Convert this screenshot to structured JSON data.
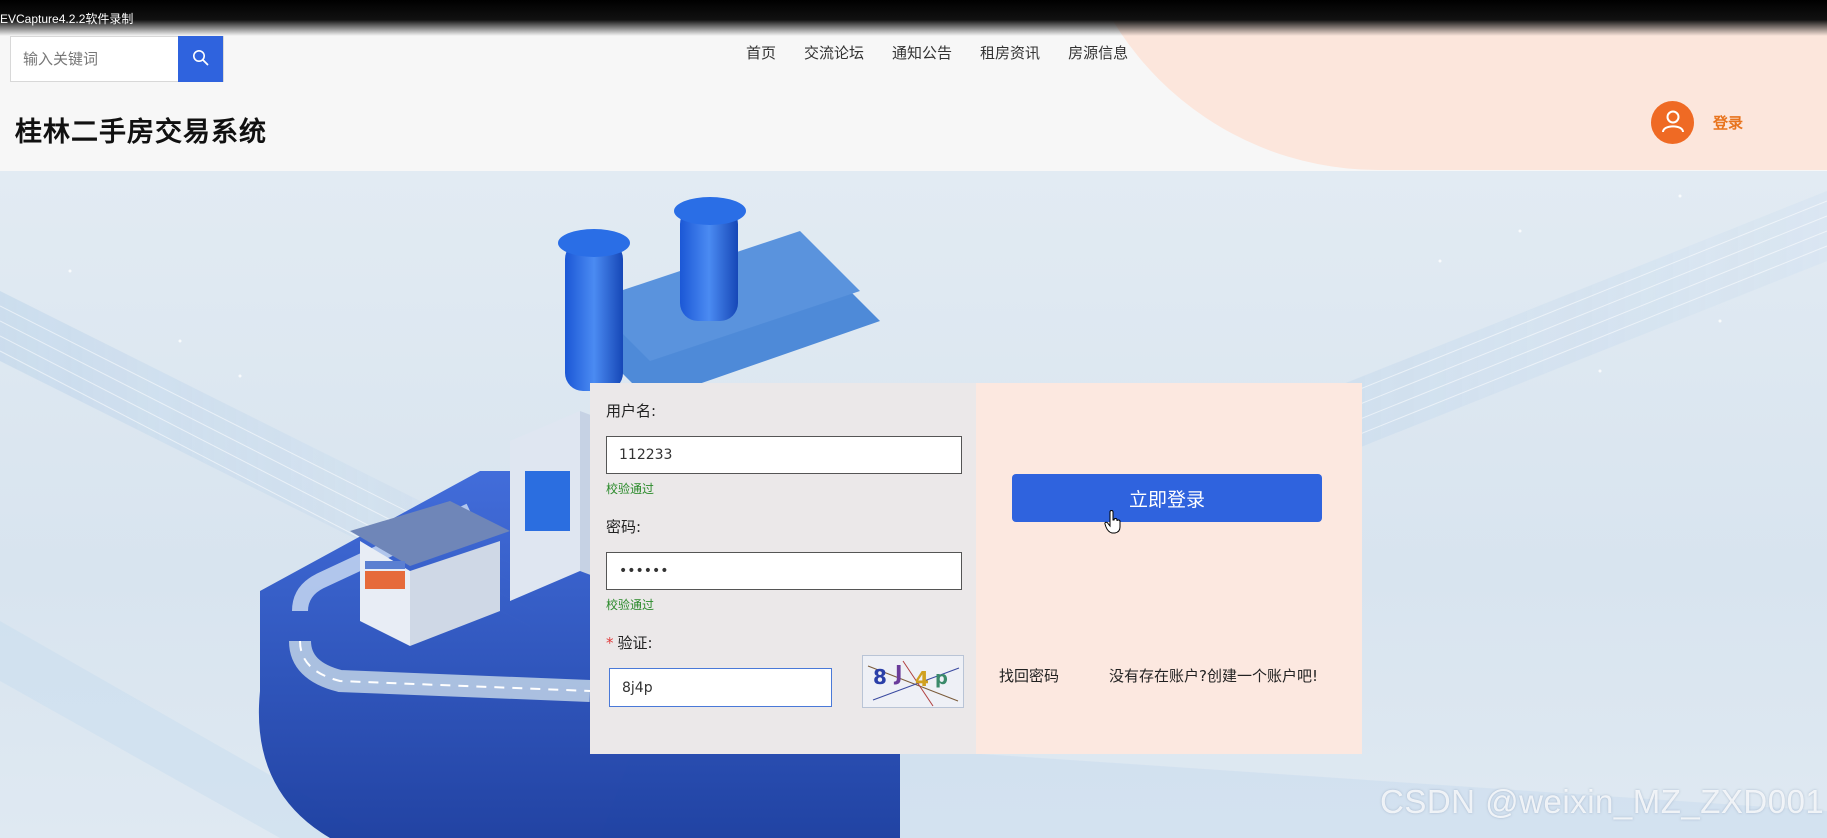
{
  "recorder": {
    "label": "EVCapture4.2.2软件录制"
  },
  "header": {
    "search": {
      "placeholder": "输入关键词"
    },
    "nav": [
      {
        "label": "首页"
      },
      {
        "label": "交流论坛"
      },
      {
        "label": "通知公告"
      },
      {
        "label": "租房资讯"
      },
      {
        "label": "房源信息"
      }
    ],
    "site_title": "桂林二手房交易系统",
    "login_label": "登录"
  },
  "login_form": {
    "username_label": "用户名:",
    "username_value": "112233",
    "username_status": "校验通过",
    "password_label": "密码:",
    "password_value": "••••••",
    "password_status": "校验通过",
    "captcha_required_mark": "*",
    "captcha_label": "验证:",
    "captcha_value": "8j4p",
    "captcha_image_text": "8J4p",
    "submit_label": "立即登录",
    "recover_password_label": "找回密码",
    "register_label": "没有存在账户?创建一个账户吧!"
  },
  "watermark": "CSDN @weixin_MZ_ZXD001",
  "colors": {
    "primary": "#2f63de",
    "accent_orange": "#ef6a24",
    "success_green": "#2a8a2a",
    "panel_left_bg": "#ebe8e9",
    "panel_right_bg": "#fce8e0"
  }
}
